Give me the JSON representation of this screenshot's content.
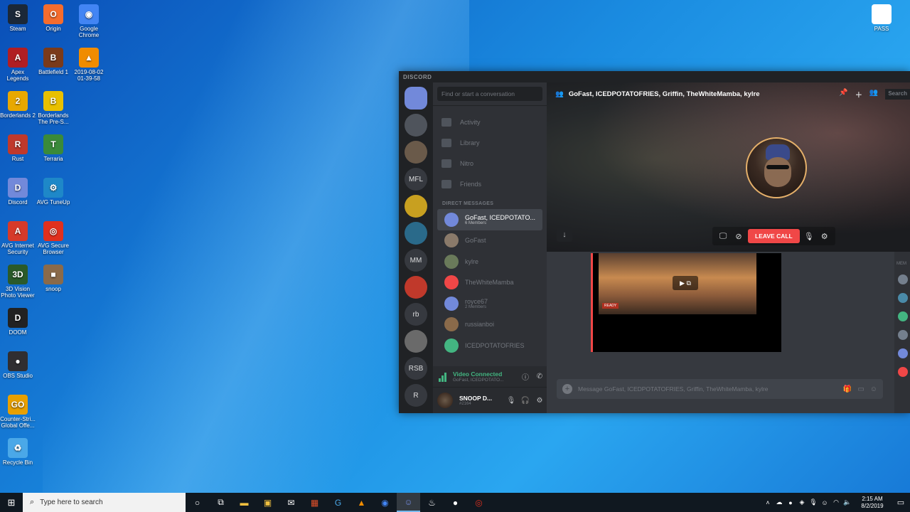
{
  "desktop": {
    "icons": [
      {
        "label": "Steam",
        "color": "#1b2838",
        "glyph": "S"
      },
      {
        "label": "Origin",
        "color": "#f56c2d",
        "glyph": "O"
      },
      {
        "label": "Google Chrome",
        "color": "#4285f4",
        "glyph": "◉"
      },
      {
        "label": "Apex Legends",
        "color": "#b01e23",
        "glyph": "A"
      },
      {
        "label": "Battlefield 1",
        "color": "#7a3a1a",
        "glyph": "B"
      },
      {
        "label": "2019-08-02 01-39-58",
        "color": "#f08c00",
        "glyph": "▲"
      },
      {
        "label": "Borderlands 2",
        "color": "#e8a800",
        "glyph": "2"
      },
      {
        "label": "Borderlands The Pre-S...",
        "color": "#e8c000",
        "glyph": "B"
      },
      {
        "label": "Rust",
        "color": "#c0392b",
        "glyph": "R"
      },
      {
        "label": "Terraria",
        "color": "#3a8a3a",
        "glyph": "T"
      },
      {
        "label": "Discord",
        "color": "#7289da",
        "glyph": "D"
      },
      {
        "label": "AVG TuneUp",
        "color": "#1e88c8",
        "glyph": "⚙"
      },
      {
        "label": "AVG Internet Security",
        "color": "#d63a2a",
        "glyph": "A"
      },
      {
        "label": "AVG Secure Browser",
        "color": "#e0301e",
        "glyph": "◎"
      },
      {
        "label": "3D Vision Photo Viewer",
        "color": "#2a5a2a",
        "glyph": "3D"
      },
      {
        "label": "snoop",
        "color": "#8a6a4a",
        "glyph": "■"
      },
      {
        "label": "DOOM",
        "color": "#222222",
        "glyph": "D"
      },
      {
        "label": "OBS Studio",
        "color": "#302e31",
        "glyph": "●"
      },
      {
        "label": "Counter-Stri... Global Offe...",
        "color": "#e8a000",
        "glyph": "GO"
      },
      {
        "label": "Recycle Bin",
        "color": "#4aa8e8",
        "glyph": "♻"
      },
      {
        "label": "PASS",
        "color": "#ffffff",
        "glyph": ""
      }
    ]
  },
  "discord": {
    "brand": "DISCORD",
    "guilds": [
      "",
      "",
      "",
      "MFL",
      "",
      "",
      "MM",
      "",
      "rb",
      "",
      "RSB",
      "R"
    ],
    "search_placeholder": "Find or start a conversation",
    "nav": [
      "Activity",
      "Library",
      "Nitro",
      "Friends"
    ],
    "dm_header": "DIRECT MESSAGES",
    "dms": [
      {
        "name": "GoFast, ICEDPOTATO...",
        "sub": "6 Members",
        "color": "#7289da",
        "active": true
      },
      {
        "name": "GoFast",
        "sub": "",
        "color": "#8a7a6a",
        "active": false
      },
      {
        "name": "kylre",
        "sub": "",
        "color": "#6a7a5a",
        "active": false
      },
      {
        "name": "TheWhiteMamba",
        "sub": "",
        "color": "#f04747",
        "active": false
      },
      {
        "name": "royce67",
        "sub": "2 Members",
        "color": "#7289da",
        "active": false
      },
      {
        "name": "russianboi",
        "sub": "",
        "color": "#8a6a4a",
        "active": false
      },
      {
        "name": "ICEDPOTATOFRIES",
        "sub": "",
        "color": "#43b581",
        "active": false
      }
    ],
    "voice": {
      "title": "Video Connected",
      "sub": "GoFast, ICEDPOTATO..."
    },
    "user": {
      "name": "SNOOP D...",
      "tag": "#2164"
    },
    "call": {
      "title": "GoFast, ICEDPOTATOFRIES, Griffin, TheWhiteMamba, kylre",
      "leave_label": "LEAVE CALL",
      "search_label": "Search"
    },
    "message_placeholder": "Message GoFast, ICEDPOTATOFRIES, Griffin, TheWhiteMamba, kylre",
    "members_label": "MEM",
    "media_thumb_text": "READY"
  },
  "taskbar": {
    "search_placeholder": "Type here to search",
    "time": "2:15 AM",
    "date": "8/2/2019"
  }
}
